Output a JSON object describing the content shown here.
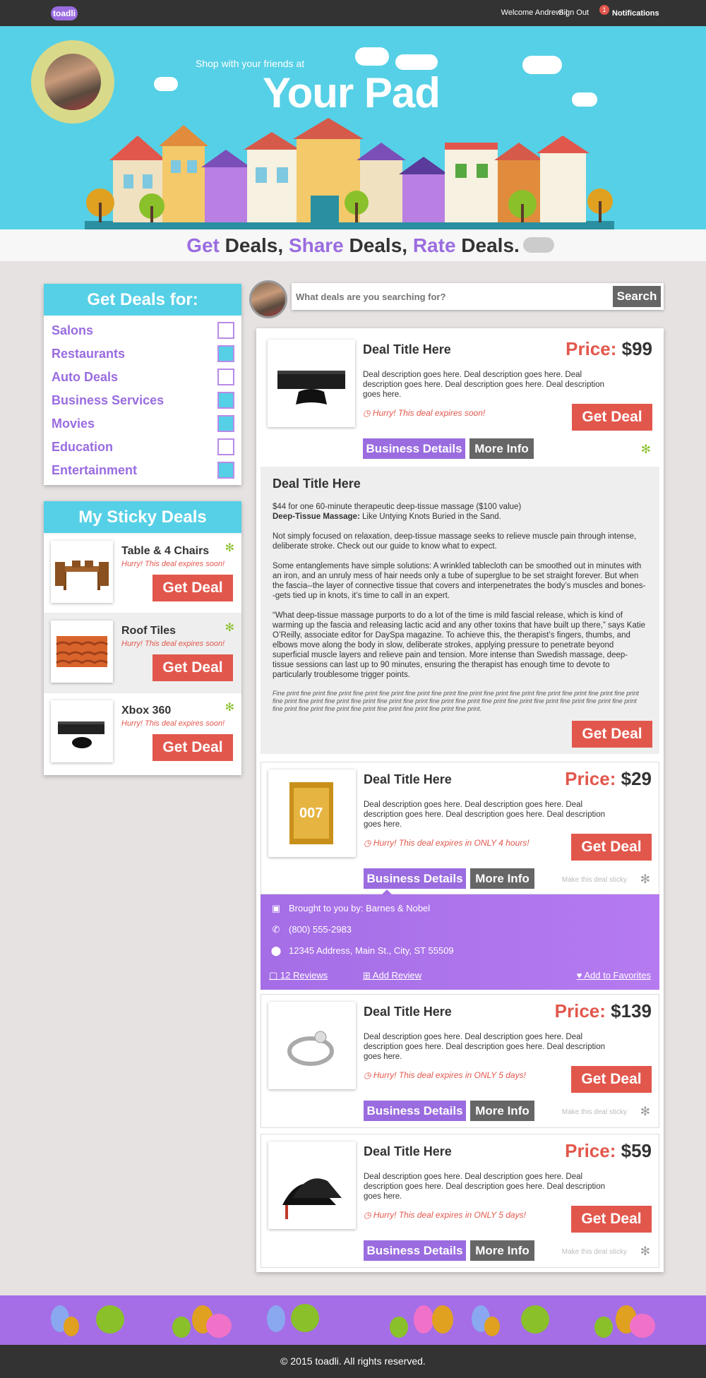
{
  "topbar": {
    "logo": "toadli",
    "welcome": "Welcome Andrew! |",
    "signout": "Sign Out",
    "notif_count": "1",
    "notif_label": "Notifications"
  },
  "hero": {
    "subtitle": "Shop with your friends at",
    "title": "Your Pad"
  },
  "tagline": {
    "w1": "Get",
    "w2": " Deals, ",
    "w3": "Share",
    "w4": " Deals, ",
    "w5": "Rate",
    "w6": " Deals."
  },
  "categories": {
    "title": "Get Deals for:",
    "items": [
      {
        "label": "Salons",
        "checked": false
      },
      {
        "label": "Restaurants",
        "checked": true
      },
      {
        "label": "Auto Deals",
        "checked": false
      },
      {
        "label": "Business Services",
        "checked": true
      },
      {
        "label": "Movies",
        "checked": true
      },
      {
        "label": "Education",
        "checked": false
      },
      {
        "label": "Entertainment",
        "checked": true
      }
    ]
  },
  "sticky": {
    "title": "My Sticky Deals",
    "items": [
      {
        "title": "Table & 4 Chairs",
        "hurry": "Hurry! This deal expires soon!",
        "button": "Get Deal"
      },
      {
        "title": "Roof Tiles",
        "hurry": "Hurry! This deal expires soon!",
        "button": "Get Deal"
      },
      {
        "title": "Xbox 360",
        "hurry": "Hurry! This deal expires soon!",
        "button": "Get Deal"
      }
    ]
  },
  "search": {
    "placeholder": "What deals are you searching for?",
    "button": "Search"
  },
  "deals": [
    {
      "title": "Deal Title Here",
      "price_label": "Price:",
      "price": "$99",
      "desc": "Deal description goes here. Deal description goes here. Deal description goes here. Deal description goes here. Deal description goes here.",
      "hurry": "Hurry! This deal expires soon!",
      "button": "Get Deal",
      "biz": "Business Details",
      "more": "More Info"
    },
    {
      "title": "Deal Title Here",
      "price_label": "Price:",
      "price": "$29",
      "desc": "Deal description goes here. Deal description goes here. Deal description goes here. Deal description goes here. Deal description goes here.",
      "hurry": "Hurry! This deal expires in ONLY 4 hours!",
      "button": "Get Deal",
      "biz": "Business Details",
      "more": "More Info",
      "sticky": "Make this deal sticky"
    },
    {
      "title": "Deal Title Here",
      "price_label": "Price:",
      "price": "$139",
      "desc": "Deal description goes here. Deal description goes here. Deal description goes here. Deal description goes here. Deal description goes here.",
      "hurry": "Hurry! This deal expires in ONLY 5 days!",
      "button": "Get Deal",
      "biz": "Business Details",
      "more": "More Info",
      "sticky": "Make this deal sticky"
    },
    {
      "title": "Deal Title Here",
      "price_label": "Price:",
      "price": "$59",
      "desc": "Deal description goes here. Deal description goes here. Deal description goes here. Deal description goes here. Deal description goes here.",
      "hurry": "Hurry! This deal expires in ONLY 5 days!",
      "button": "Get Deal",
      "biz": "Business Details",
      "more": "More Info",
      "sticky": "Make this deal sticky"
    }
  ],
  "moreinfo": {
    "title": "Deal Title Here",
    "p1a": "$44 for one 60-minute therapeutic deep-tissue massage ($100 value)",
    "p1b_bold": "Deep-Tissue Massage:",
    "p1b": " Like  Untying Knots Buried in the Sand.",
    "p2": "Not simply focused on relaxation, deep-tissue massage seeks to relieve muscle pain through intense, deliberate stroke. Check out our guide to know what to expect.",
    "p3": "Some entanglements have simple solutions: A wrinkled tablecloth can be smoothed out in minutes with an iron, and an unruly mess of hair needs only a tube of superglue to be set straight forever. But when the fascia--the layer of connective tissue that covers and interpenetrates the body’s muscles and bones--gets tied up in knots, it’s time to call in an expert.",
    "p4": "“What deep-tissue massage purports to do a lot of the time is mild fascial release, which is kind of warming up the fascia and releasing lactic acid and any other toxins that have built up there,” says Katie O’Reilly, associate editor for DaySpa magazine. To achieve this, the therapist’s fingers, thumbs, and elbows move along the body in slow, deliberate strokes, applying pressure to penetrate beyond superficial muscle layers and relieve pain and tension. More intense than Swedish massage, deep-tissue sessions can last up to 90 minutes, ensuring the therapist has enough time to devote to particularly troublesome trigger points.",
    "fine": "Fine print fine print fine print fine print fine print fine print fine print fine print fine print fine print fine print fine print fine print fine print fine print fine print fine print fine print fine print fine print fine print fine print fine print fine print fine print fine print fine print fine print fine print fine print fine print fine print fine print fine print fine print fine print.",
    "button": "Get Deal"
  },
  "business": {
    "by": "Brought to you by: Barnes & Nobel",
    "phone": "(800) 555-2983",
    "address": "12345 Address, Main St., City, ST 55509",
    "reviews": "12 Reviews",
    "add_review": "Add Review",
    "favorites": "Add to Favorites"
  },
  "footer": {
    "copyright": "© 2015 toadli. All rights reserved."
  },
  "colors": {
    "accent_blue": "#56d0e6",
    "accent_purple": "#9a6ce0",
    "cta_red": "#e2574c",
    "dark": "#333333"
  }
}
